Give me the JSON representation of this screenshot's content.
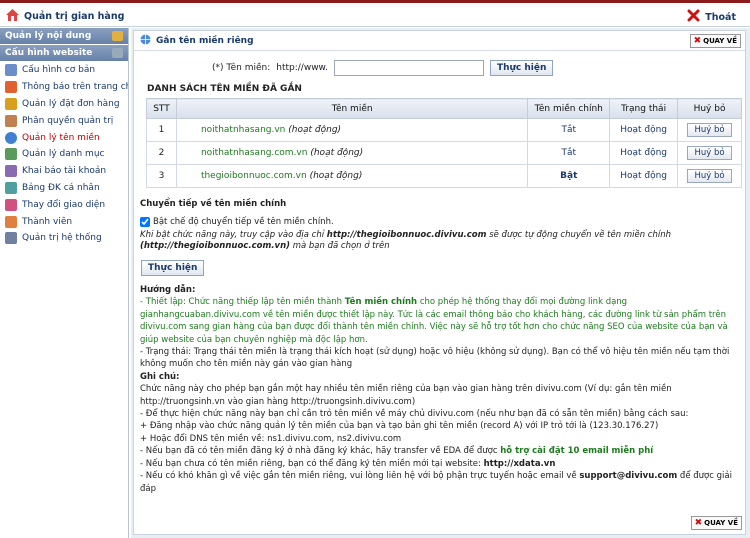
{
  "header": {
    "home_label": "Quản trị gian hàng",
    "logout_label": "Thoát"
  },
  "sidebar": {
    "section1": "Quản lý nội dung",
    "section2": "Cấu hình website",
    "items": [
      {
        "label": "Cấu hình cơ bản"
      },
      {
        "label": "Thông báo trên trang chủ"
      },
      {
        "label": "Quản lý đặt đơn hàng"
      },
      {
        "label": "Phân quyền quản trị"
      },
      {
        "label": "Quản lý tên miền"
      },
      {
        "label": "Quản lý danh mục"
      },
      {
        "label": "Khai báo tài khoản"
      },
      {
        "label": "Bảng ĐK cá nhân"
      },
      {
        "label": "Thay đổi giao diện"
      },
      {
        "label": "Thành viên"
      },
      {
        "label": "Quản trị hệ thống"
      }
    ]
  },
  "panel": {
    "title": "Gắn tên miền riêng",
    "back_label": "QUAY VỀ"
  },
  "form": {
    "domain_label": "(*) Tên miền:",
    "prefix": "http://www.",
    "input_value": "",
    "submit_label": "Thực hiện"
  },
  "list": {
    "title": "DANH SÁCH TÊN MIỀN ĐÃ GẮN",
    "headers": [
      "STT",
      "Tên miền",
      "Tên miền chính",
      "Trạng thái",
      "Huỷ bỏ"
    ],
    "rows": [
      {
        "stt": "1",
        "domain": "noithatnhasang.vn",
        "note": "(hoạt động)",
        "main": "Tắt",
        "status": "Hoạt động",
        "cancel": "Huỷ bỏ"
      },
      {
        "stt": "2",
        "domain": "noithatnhasang.com.vn",
        "note": "(hoạt động)",
        "main": "Tắt",
        "status": "Hoạt động",
        "cancel": "Huỷ bỏ"
      },
      {
        "stt": "3",
        "domain": "thegioibonnuoc.com.vn",
        "note": "(hoạt động)",
        "main": "Bật",
        "status": "Hoạt động",
        "cancel": "Huỷ bỏ"
      }
    ]
  },
  "redirect": {
    "title": "Chuyển tiếp về tên miền chính",
    "checkbox_label": "Bật chế độ chuyển tiếp về tên miền chính.",
    "desc1": "Khi bật chức năng này, truy cập vào địa chỉ ",
    "desc_url1": "http://thegioibonnuoc.divivu.com",
    "desc2": " sẽ được tự động chuyển về tên miền chính",
    "desc_url2": "(http://thegioibonnuoc.com.vn)",
    "desc3": " mà bạn đã chọn ở trên",
    "button_label": "Thực hiện"
  },
  "guide": {
    "title": "Hướng dẫn:",
    "p1a": "- Thiết lập: Chức năng thiếp lập tên miền thành ",
    "p1b": "Tên miền chính",
    "p1c": " cho phép hệ thống thay đổi mọi đường link dạng gianhangcuaban.divivu.com về tên miền được thiết lập này. Tức là các email thông báo cho khách hàng, các đường link từ sản phẩm trên divivu.com sang gian hàng của bạn được đổi thành tên miền chính. Việc này sẽ hỗ trợ tốt hơn cho chức năng SEO của website của bạn và giúp website của bạn chuyên nghiệp mà độc lập hơn.",
    "p2": "- Trạng thái: Trạng thái tên miền là trạng thái kích hoạt (sử dụng) hoặc vô hiệu (không sử dụng). Bạn có thể vô hiệu tên miền nếu tạm thời không muốn cho tên miền này gán vào gian hàng",
    "note_title": "Ghi chú:",
    "n1": "Chức năng này cho phép bạn gắn một hay nhiều tên miền riêng của bạn vào gian hàng trên divivu.com (Ví dụ: gắn tên miền http://truongsinh.vn vào gian hàng http://truongsinh.divivu.com)",
    "n2": "- Để thực hiện chức năng này bạn chỉ cần trỏ tên miền về máy chủ divivu.com (nếu như bạn đã có sẵn tên miền) bằng cách sau:",
    "n3": "+ Đăng nhập vào chức năng quản lý tên miền của bạn và tạo bản ghi tên miền (record A) với IP trỏ tới là (123.30.176.27)",
    "n4": "+ Hoặc đổi DNS tên miền về: ns1.divivu.com, ns2.divivu.com",
    "n5a": "- Nếu bạn đã có tên miền đăng ký ở nhà đăng ký khác, hãy transfer về EDA để được ",
    "n5b": "hỗ trợ cài đặt 10 email miễn phí",
    "n6a": "- Nếu bạn chưa có tên miền riêng, bạn có thể đăng ký tên miền mới tại website: ",
    "n6b": "http://xdata.vn",
    "n7a": "- Nếu có khó khăn gì về việc gắn tên miền riêng, vui lòng liên hệ với bộ phận trực tuyến hoặc email về ",
    "n7b": "support@divivu.com",
    "n7c": " để được giải đáp"
  }
}
